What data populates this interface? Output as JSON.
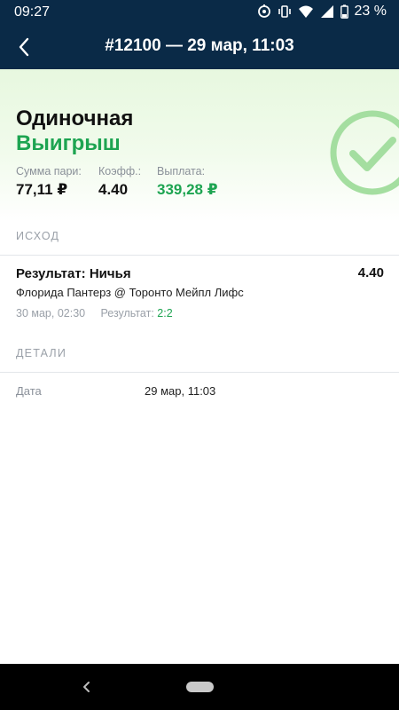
{
  "status_bar": {
    "time": "09:27",
    "battery": "23 %",
    "icons": [
      "sync-icon",
      "vibrate-icon",
      "wifi-icon",
      "cellular-signal-icon",
      "battery-icon"
    ]
  },
  "header": {
    "title": "#12100 — 29 мар, 11:03",
    "back_icon": "chevron-left-icon"
  },
  "bet": {
    "type": "Одиночная",
    "status": "Выигрыш",
    "stake_label": "Сумма пари:",
    "stake_value": "77,11 ₽",
    "odds_label": "Коэфф.:",
    "odds_value": "4.40",
    "payout_label": "Выплата:",
    "payout_value": "339,28 ₽",
    "badge_icon": "check-circle-icon"
  },
  "outcome_section": {
    "title": "ИСХОД",
    "result": "Результат: Ничья",
    "odds": "4.40",
    "match": "Флорида Пантерз @ Торонто Мейпл Лифс",
    "datetime": "30 мар, 02:30",
    "score_label": "Результат:",
    "score": "2:2"
  },
  "details_section": {
    "title": "ДЕТАЛИ",
    "rows": [
      {
        "label": "Дата",
        "value": "29 мар, 11:03"
      }
    ]
  },
  "colors": {
    "header_bg": "#0a2a47",
    "win_green": "#1da451",
    "hero_gradient_top": "#e7f8df",
    "badge_green": "#9fdc9a"
  }
}
